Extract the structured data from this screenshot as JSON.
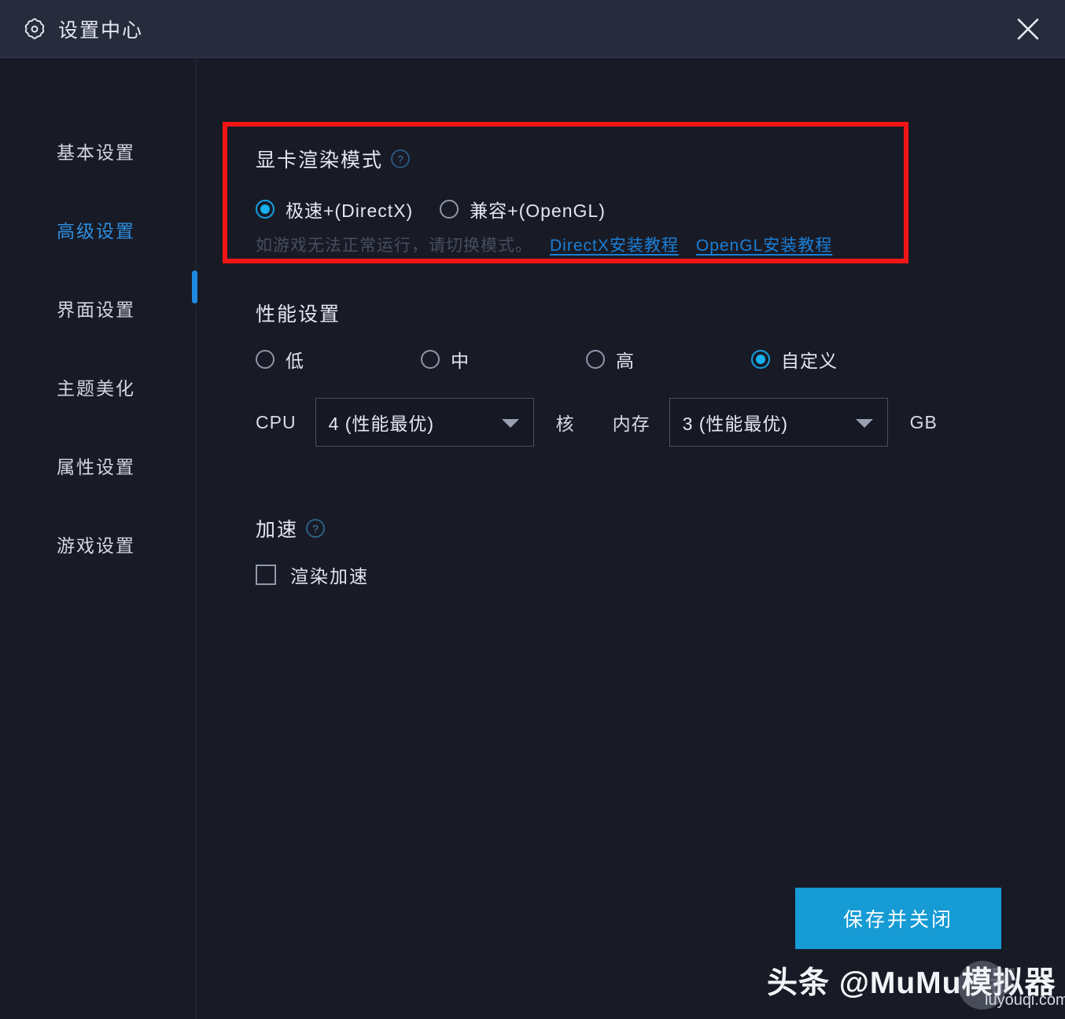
{
  "window": {
    "title": "设置中心",
    "gear_icon": "gear-icon",
    "close_icon": "close-icon"
  },
  "sidebar": {
    "items": [
      {
        "label": "基本设置",
        "active": false
      },
      {
        "label": "高级设置",
        "active": true
      },
      {
        "label": "界面设置",
        "active": false
      },
      {
        "label": "主题美化",
        "active": false
      },
      {
        "label": "属性设置",
        "active": false
      },
      {
        "label": "游戏设置",
        "active": false
      }
    ]
  },
  "render_mode": {
    "title": "显卡渲染模式",
    "help_icon": "help-icon",
    "options": [
      {
        "label": "极速+(DirectX)",
        "checked": true
      },
      {
        "label": "兼容+(OpenGL)",
        "checked": false
      }
    ],
    "hint": "如游戏无法正常运行，请切换模式。",
    "links": [
      {
        "label": "DirectX安装教程"
      },
      {
        "label": "OpenGL安装教程"
      }
    ]
  },
  "performance": {
    "title": "性能设置",
    "options": [
      {
        "label": "低",
        "checked": false
      },
      {
        "label": "中",
        "checked": false
      },
      {
        "label": "高",
        "checked": false
      },
      {
        "label": "自定义",
        "checked": true
      }
    ],
    "cpu": {
      "label": "CPU",
      "value": "4 (性能最优)",
      "unit": "核"
    },
    "memory": {
      "label": "内存",
      "value": "3 (性能最优)",
      "unit": "GB"
    }
  },
  "acceleration": {
    "title": "加速",
    "help_icon": "help-icon",
    "checkbox": {
      "label": "渲染加速",
      "checked": false
    }
  },
  "footer": {
    "save_label": "保存并关闭"
  },
  "watermark": {
    "text": "头条 @MuMu模拟器",
    "ghost_text": "器",
    "site": "luyouqi.com"
  },
  "colors": {
    "accent": "#169bd5",
    "radio_accent": "#17b0f0",
    "link": "#1b7fd6",
    "active_nav": "#2e8fe0",
    "highlight_box": "#f31515",
    "titlebar_bg": "#272c3d",
    "body_bg": "#181b26"
  }
}
